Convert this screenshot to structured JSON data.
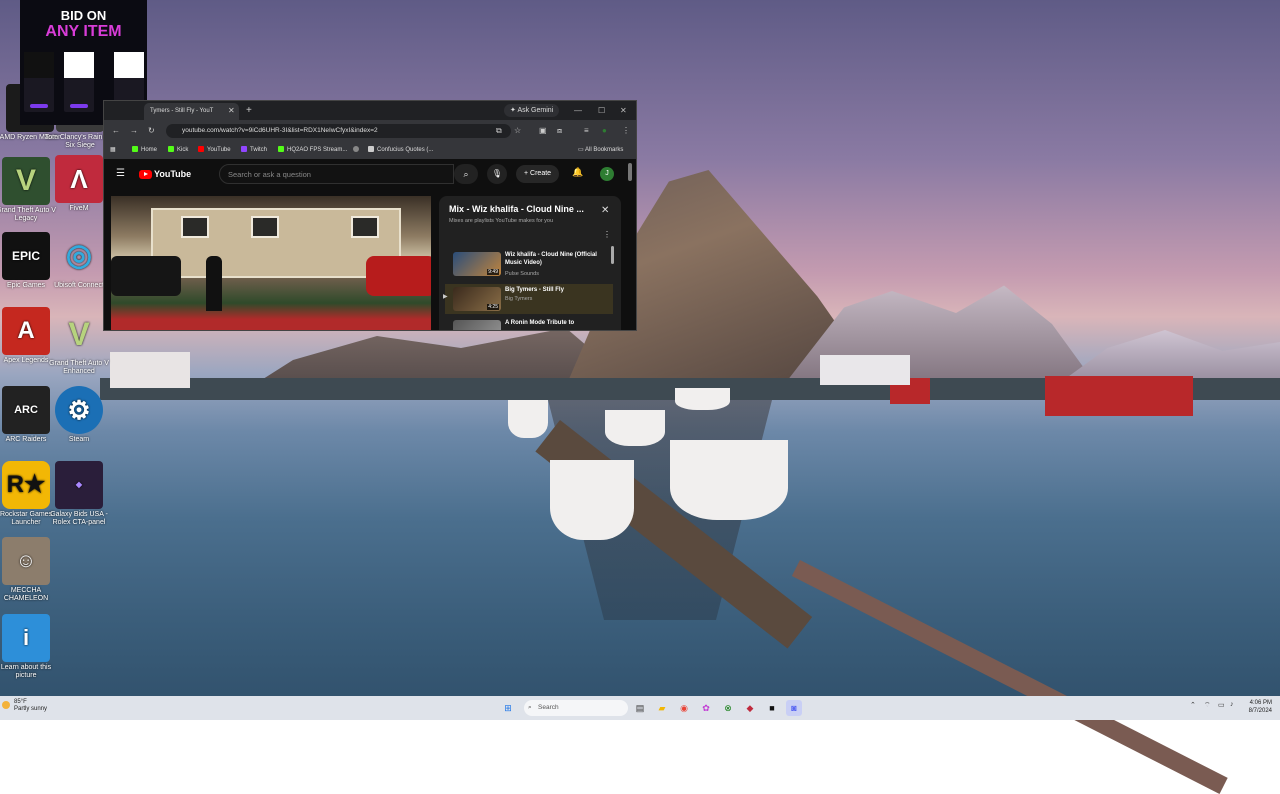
{
  "ad": {
    "line1": "BID ON",
    "line2": "ANY ITEM"
  },
  "desktop_icons": [
    {
      "label": "AMD Ryzen Master"
    },
    {
      "label": "Tom Clancy's Rainbow Six Siege"
    },
    {
      "label": "Grand Theft Auto V Legacy"
    },
    {
      "label": "FiveM"
    },
    {
      "label": "Epic Games"
    },
    {
      "label": "Ubisoft Connect"
    },
    {
      "label": "Apex Legends"
    },
    {
      "label": "Grand Theft Auto V Enhanced"
    },
    {
      "label": "ARC Raiders"
    },
    {
      "label": "Steam"
    },
    {
      "label": "Rockstar Games Launcher"
    },
    {
      "label": "Galaxy Bids USA - Rolex CTA-panel"
    },
    {
      "label": "MECCHA CHAMELEON"
    },
    {
      "label": "Learn about this picture"
    }
  ],
  "browser": {
    "tab_title": "Tymers - Still Fly - YouT",
    "ask_gemini": "Ask Gemini",
    "url": "youtube.com/watch?v=9iCd6UHR-3I&list=RDX1NeIwCfyxI&index=2",
    "bookmarks": [
      {
        "label": "Home",
        "color": "#53fc18"
      },
      {
        "label": "Kick",
        "color": "#53fc18"
      },
      {
        "label": "YouTube",
        "color": "#ff0000"
      },
      {
        "label": "Twitch",
        "color": "#9146ff"
      },
      {
        "label": "HQ2AO FPS Stream...",
        "color": "#53fc18"
      },
      {
        "label": "",
        "color": "#888888"
      },
      {
        "label": "Confucius Quotes (...",
        "color": "#cccccc"
      }
    ],
    "all_bookmarks": "All Bookmarks"
  },
  "youtube": {
    "logo": "YouTube",
    "search_placeholder": "Search or ask a question",
    "create_label": "Create",
    "avatar_letter": "J",
    "playlist": {
      "title": "Mix - Wiz khalifa - Cloud Nine ...",
      "subtitle": "Mixes are playlists YouTube makes for you",
      "items": [
        {
          "title": "Wiz khalifa - Cloud Nine (Official Music Video)",
          "channel": "Pulse Sounds",
          "duration": "9:49"
        },
        {
          "title": "Big Tymers - Still Fly",
          "channel": "Big Tymers",
          "duration": "4:25"
        },
        {
          "title": "A Ronin Mode Tribute to",
          "channel": "",
          "duration": ""
        }
      ]
    }
  },
  "taskbar": {
    "weather_temp": "85°F",
    "weather_desc": "Partly sunny",
    "search_placeholder": "Search",
    "time": "4:06 PM",
    "date": "8/7/2024"
  }
}
